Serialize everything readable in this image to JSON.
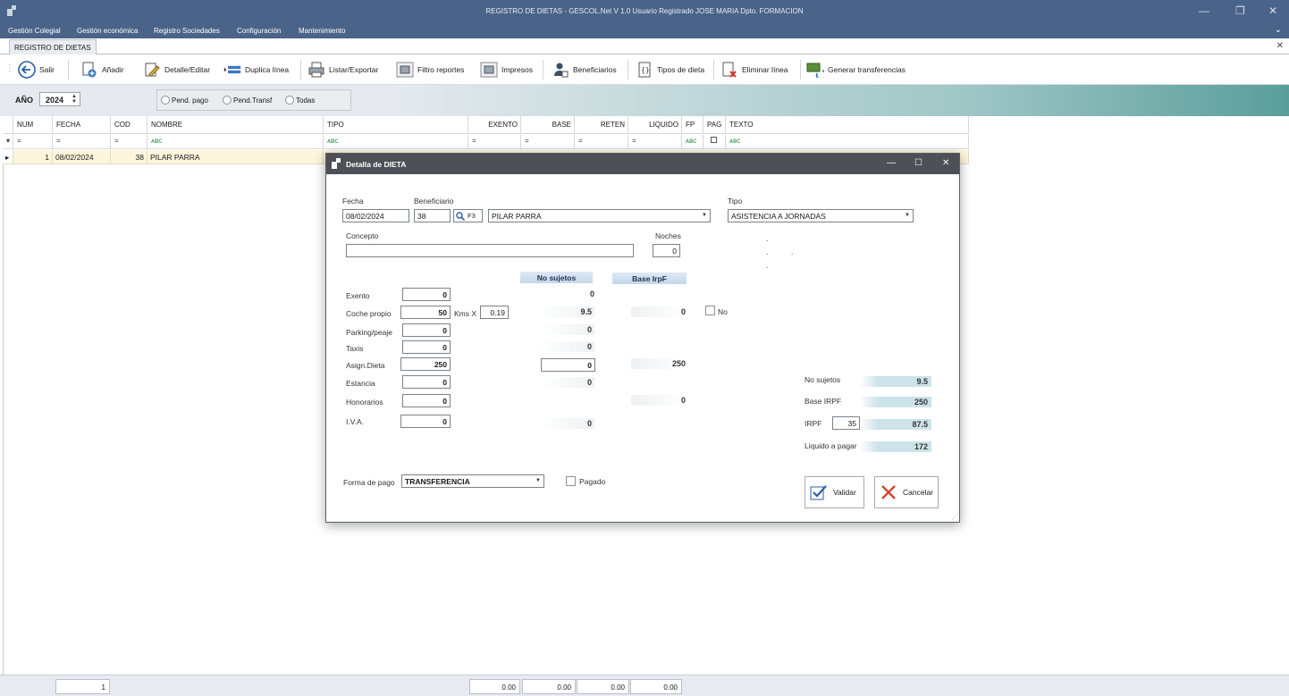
{
  "window": {
    "title": "REGISTRO DE DIETAS - GESCOL.Net V 1.0  Usuario Registrado JOSE MARIA  Dpto. FORMACION"
  },
  "menu": [
    "Gestión Colegial",
    "Gestión económica",
    "Registro Sociedades",
    "Configuración",
    "Mantenimiento"
  ],
  "tab": {
    "label": "REGISTRO DE DIETAS"
  },
  "toolbar": {
    "salir": "Salir",
    "anadir": "Añadir",
    "detalle": "Detalle/Editar",
    "duplica": "Duplica línea",
    "listar": "Listar/Exportar",
    "filtro": "Filtro reportes",
    "impresos": "Impresos",
    "beneficiarios": "Beneficiarios",
    "tipos": "Tipos de dieta",
    "eliminar": "Eliminar línea",
    "generar": "Generar transferencias"
  },
  "filter": {
    "year_label": "AÑO",
    "year_value": "2024",
    "radio_pend_pago": "Pend. pago",
    "radio_pend_transf": "Pend.Transf",
    "radio_todas": "Todas"
  },
  "grid": {
    "columns": [
      "NUM",
      "FECHA",
      "COD",
      "NOMBRE",
      "TIPO",
      "EXENTO",
      "BASE",
      "RETEN",
      "LIQUIDO",
      "FP",
      "PAG",
      "TEXTO"
    ],
    "filter_eq": "=",
    "filter_abc": "ᴀʙc",
    "row": {
      "num": "1",
      "fecha": "08/02/2024",
      "cod": "38",
      "nombre": "PILAR PARRA"
    }
  },
  "footer": {
    "count": "1",
    "exento": "0.00",
    "base": "0.00",
    "reten": "0.00",
    "liquido": "0.00"
  },
  "dialog": {
    "title": "Detalla de DIETA",
    "fecha_label": "Fecha",
    "fecha": "08/02/2024",
    "beneficiario_label": "Beneficiario",
    "cod": "38",
    "f3": "F3",
    "nombre": "PILAR PARRA",
    "tipo_label": "Tipo",
    "tipo": "ASISTENCIA A JORNADAS",
    "concepto_label": "Concepto",
    "concepto": "",
    "noches_label": "Noches",
    "noches": "0",
    "dot": ".",
    "hdr_no_sujetos": "No sujetos",
    "hdr_base_irpf": "Base IrpF",
    "rows": {
      "exento": {
        "label": "Exento",
        "input": "0",
        "nosuj": "0"
      },
      "coche": {
        "label": "Coche propio",
        "input": "50",
        "kms_label": "Kms X",
        "kms": "0.19",
        "nosuj": "9.5",
        "base": "0",
        "no_label": "No"
      },
      "parking": {
        "label": "Parking/peaje",
        "input": "0",
        "nosuj": "0"
      },
      "taxis": {
        "label": "Taxis",
        "input": "0",
        "nosuj": "0"
      },
      "asign": {
        "label": "Asign.Dieta",
        "input": "250",
        "nosuj": "0",
        "base": "250"
      },
      "estancia": {
        "label": "Estancia",
        "input": "0",
        "nosuj": "0"
      },
      "honorarios": {
        "label": "Honorarios",
        "input": "0",
        "base": "0"
      },
      "iva": {
        "label": "I.V.A.",
        "input": "0",
        "nosuj": "0"
      }
    },
    "totals": {
      "no_sujetos_label": "No sujetos",
      "no_sujetos": "9.5",
      "base_irpf_label": "Base IRPF",
      "base_irpf": "250",
      "irpf_label": "IRPF",
      "irpf_pct": "35",
      "irpf": "87.5",
      "liquido_label": "Liquido a pagar",
      "liquido": "172"
    },
    "forma_pago_label": "Forma de pago",
    "forma_pago": "TRANSFERENCIA",
    "pagado_label": "Pagado",
    "validar": "Validar",
    "cancelar": "Cancelar"
  }
}
